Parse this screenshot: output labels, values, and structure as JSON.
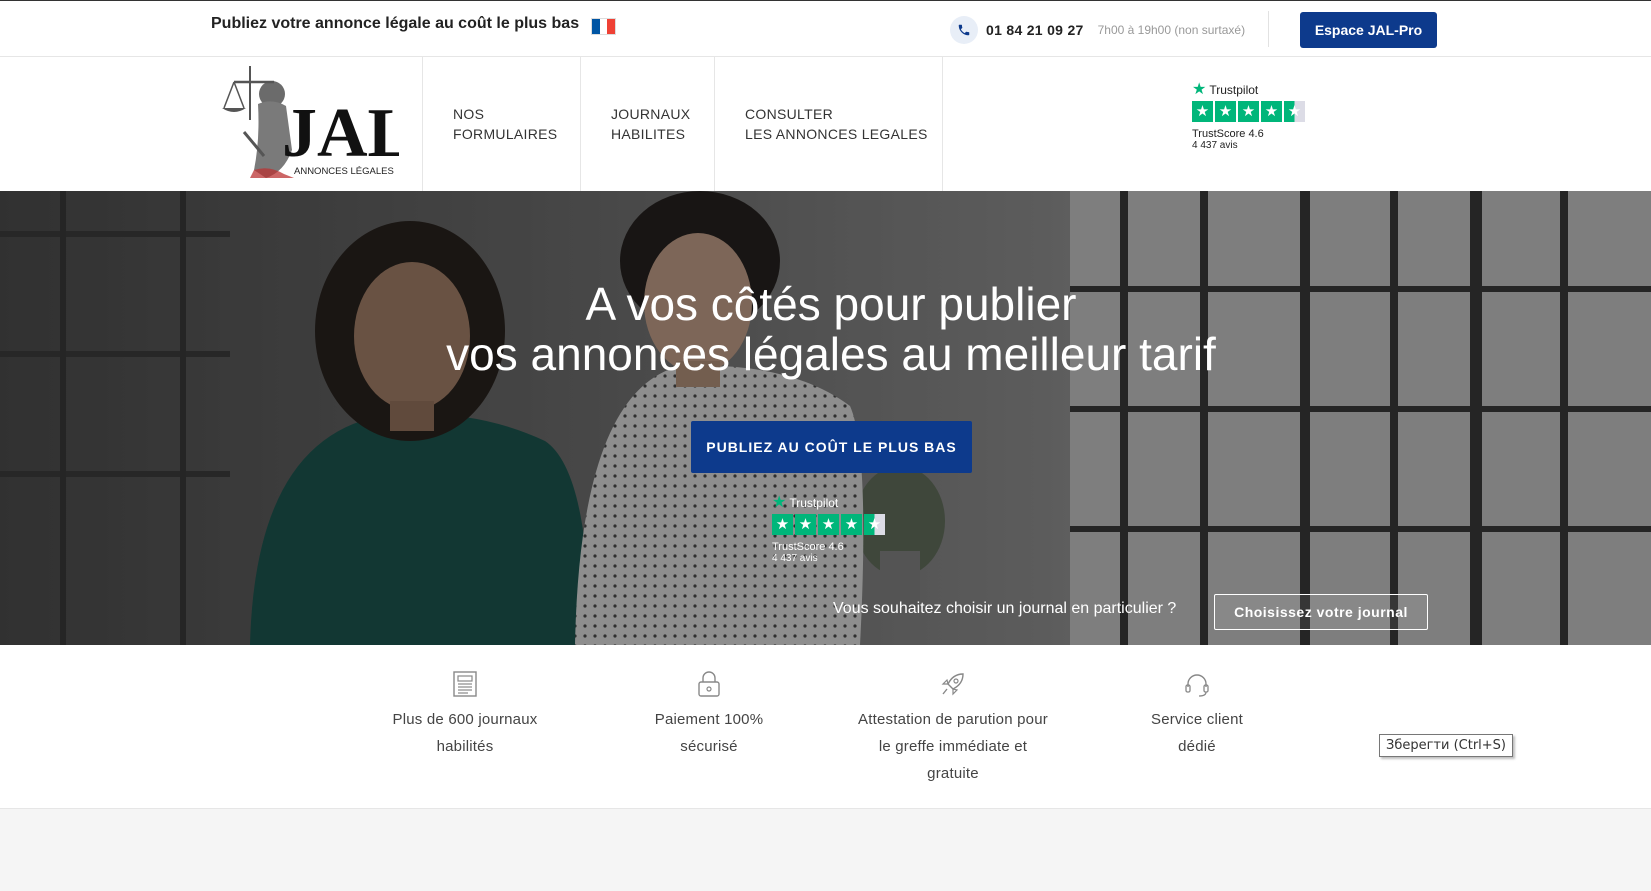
{
  "topbar": {
    "tagline": "Publiez votre annonce légale au coût le plus bas",
    "phone": "01 84 21 09 27",
    "hours": "7h00 à 19h00 (non surtaxé)",
    "pro_button": "Espace JAL-Pro"
  },
  "logo": {
    "letters": "JAL",
    "subtitle": "ANNONCES LÉGALES"
  },
  "nav": {
    "items": [
      {
        "line1": "NOS",
        "line2": "FORMULAIRES"
      },
      {
        "line1": "JOURNAUX",
        "line2": "HABILITES"
      },
      {
        "line1": "CONSULTER",
        "line2": "LES ANNONCES LEGALES"
      }
    ]
  },
  "trustpilot": {
    "brand": "Trustpilot",
    "score": "TrustScore 4.6",
    "reviews": "4 437 avis",
    "rating": 4.5
  },
  "hero": {
    "title_line1": "A vos côtés pour publier",
    "title_line2": "vos annonces légales au meilleur tarif",
    "cta": "PUBLIEZ AU COÛT LE PLUS BAS",
    "choose_text": "Vous souhaitez choisir un journal en particulier ?",
    "choose_button": "Choisissez votre journal"
  },
  "features": [
    {
      "icon": "newspaper-icon",
      "line1": "Plus de 600 journaux",
      "line2": "habilités",
      "line3": ""
    },
    {
      "icon": "lock-icon",
      "line1": "Paiement 100%",
      "line2": "sécurisé",
      "line3": ""
    },
    {
      "icon": "rocket-icon",
      "line1": "Attestation de parution pour",
      "line2": "le greffe immédiate et",
      "line3": "gratuite"
    },
    {
      "icon": "headset-icon",
      "line1": "Service client",
      "line2": "dédié",
      "line3": ""
    }
  ],
  "tooltip": "Зберегти (Ctrl+S)",
  "colors": {
    "primary": "#0d3a8c",
    "trustpilot_green": "#00b67a",
    "flag_blue": "#0055a4",
    "flag_red": "#ef4135"
  }
}
